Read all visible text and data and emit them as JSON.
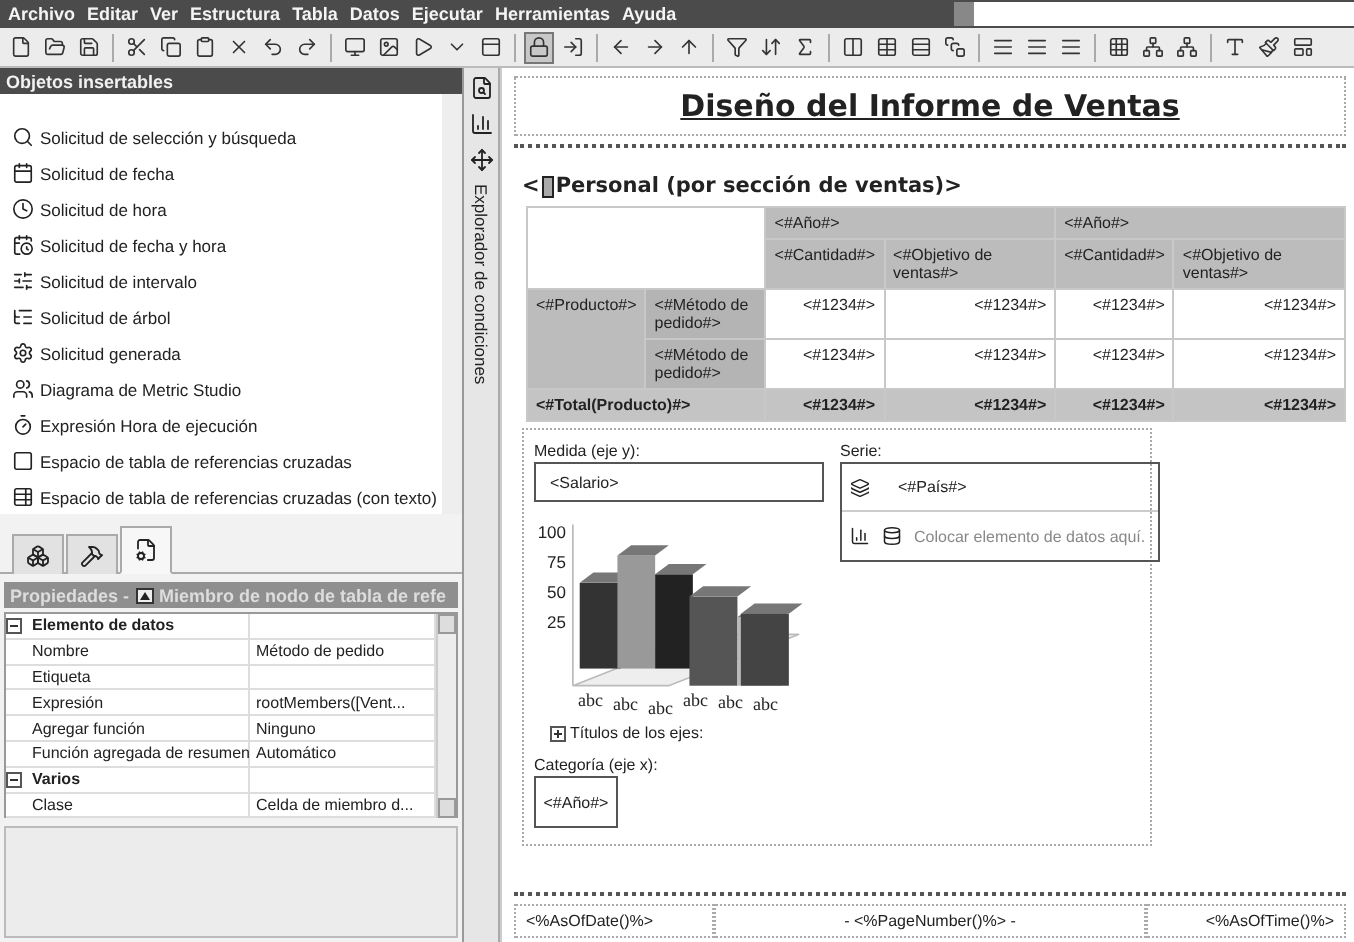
{
  "menu": [
    "Archivo",
    "Editar",
    "Ver",
    "Estructura",
    "Tabla",
    "Datos",
    "Ejecutar",
    "Herramientas",
    "Ayuda"
  ],
  "toolbar": {
    "lock_pressed": true
  },
  "insertable_panel": {
    "title": "Objetos insertables",
    "items": [
      "Solicitud de selección y búsqueda",
      "Solicitud de fecha",
      "Solicitud de hora",
      "Solicitud de fecha y hora",
      "Solicitud de intervalo",
      "Solicitud de árbol",
      "Solicitud generada",
      "Diagrama de Metric Studio",
      "Expresión Hora de ejecución",
      "Espacio de tabla de referencias cruzadas",
      "Espacio de tabla de referencias cruzadas (con texto)"
    ]
  },
  "panel_tabs": [
    {
      "selected": false
    },
    {
      "selected": false
    },
    {
      "selected": true
    }
  ],
  "properties": {
    "title_prefix": "Propiedades -",
    "title": "Miembro de nodo de tabla de refe",
    "groups": [
      {
        "name": "Elemento de datos",
        "expanded": true,
        "rows": [
          [
            "Nombre",
            "Método de pedido"
          ],
          [
            "Etiqueta",
            ""
          ],
          [
            "Expresión",
            "rootMembers([Vent..."
          ],
          [
            "Agregar función",
            "Ninguno"
          ],
          [
            "Función agregada de resumen",
            "Automático"
          ]
        ]
      },
      {
        "name": "Varios",
        "expanded": true,
        "rows": [
          [
            "Clase",
            "Celda de miembro d..."
          ]
        ]
      }
    ]
  },
  "side_strip": {
    "label": "Explorador de condiciones"
  },
  "report": {
    "title": "Diseño del Informe de Ventas",
    "list_open": "<",
    "list_label": "Personal (por sección de ventas)>",
    "crosstab": {
      "years": [
        "<#Año#>",
        "<#Año#>"
      ],
      "measures": [
        "<#Cantidad#>",
        "<#Objetivo de ventas#>",
        "<#Cantidad#>",
        "<#Objetivo de ventas#>"
      ],
      "product": "<#Producto#>",
      "rows": [
        {
          "member": "<#Método de pedido#>",
          "values": [
            "<#1234#>",
            "<#1234#>",
            "<#1234#>",
            "<#1234#>"
          ]
        },
        {
          "member": "<#Método de pedido#>",
          "values": [
            "<#1234#>",
            "<#1234#>",
            "<#1234#>",
            "<#1234#>"
          ]
        }
      ],
      "total": {
        "label": "<#Total(Producto)#>",
        "values": [
          "<#1234#>",
          "<#1234#>",
          "<#1234#>",
          "<#1234#>"
        ]
      }
    },
    "chart": {
      "measure_label": "Medida (eje y):",
      "measure_value": "<Salario>",
      "series_label": "Serie:",
      "series_value": "<#País#>",
      "drop_hint": "Colocar elemento de datos aquí.",
      "yticks": [
        "100",
        "75",
        "50",
        "25"
      ],
      "categories": [
        "abc",
        "abc",
        "abc",
        "abc",
        "abc",
        "abc"
      ],
      "axis_titles": {
        "label": "Títulos de los ejes:",
        "expanded": false
      },
      "category_label": "Categoría (eje x):",
      "category_value": "<#Año#>"
    },
    "footer": [
      "<%AsOfDate()%>",
      "- <%PageNumber()%> -",
      "<%AsOfTime()%>"
    ]
  }
}
